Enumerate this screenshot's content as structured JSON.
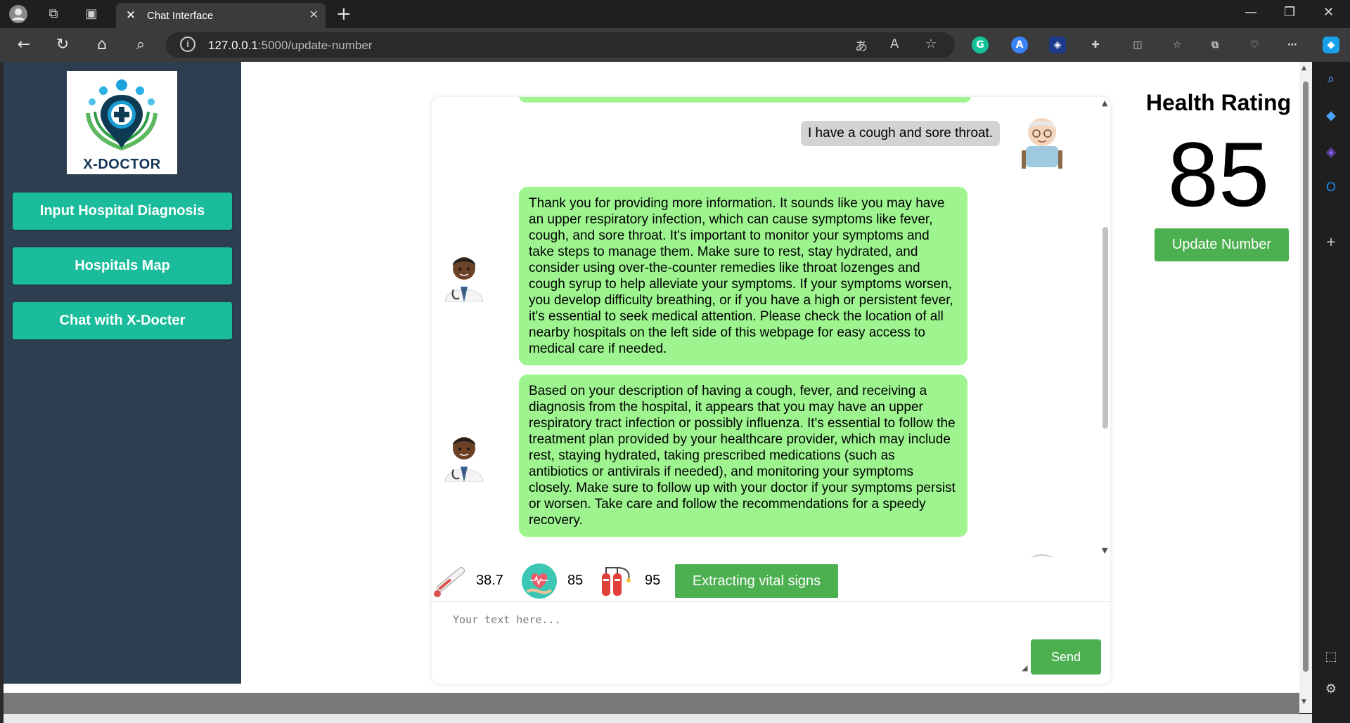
{
  "browser": {
    "tab_title": "Chat Interface",
    "url_host": "127.0.0.1",
    "url_path": ":5000/update-number"
  },
  "sidebar": {
    "logo_text": "X-DOCTOR",
    "items": [
      {
        "label": "Input Hospital Diagnosis"
      },
      {
        "label": "Hospitals Map"
      },
      {
        "label": "Chat with X-Docter"
      }
    ]
  },
  "chat": {
    "user_message": "I have a cough and sore throat.",
    "bot_messages": [
      {
        "text": "Thank you for providing more information. It sounds like you may have an upper respiratory infection, which can cause symptoms like fever, cough, and sore throat. It's important to monitor your symptoms and take steps to manage them. Make sure to rest, stay hydrated, and consider using over-the-counter remedies like throat lozenges and cough syrup to help alleviate your symptoms. If your symptoms worsen, you develop difficulty breathing, or if you have a high or persistent fever, it's essential to seek medical attention. Please check the location of all nearby hospitals on the left side of this webpage for easy access to medical care if needed."
      },
      {
        "text": "Based on your description of having a cough, fever, and receiving a diagnosis from the hospital, it appears that you may have an upper respiratory tract infection or possibly influenza. It's essential to follow the treatment plan provided by your healthcare provider, which may include rest, staying hydrated, taking prescribed medications (such as antibiotics or antivirals if needed), and monitoring your symptoms closely. Make sure to follow up with your doctor if your symptoms persist or worsen. Take care and follow the recommendations for a speedy recovery."
      }
    ],
    "input_placeholder": "Your text here...",
    "send_label": "Send"
  },
  "vitals": {
    "temperature": "38.7",
    "heart_rate": "85",
    "oxygen": "95",
    "extract_label": "Extracting vital signs"
  },
  "health": {
    "title": "Health Rating",
    "value": "85",
    "update_label": "Update Number"
  },
  "colors": {
    "sidebar_bg": "#2c3e50",
    "nav_button": "#1abc9c",
    "bot_bubble": "#9ef590",
    "user_bubble": "#d3d3d3",
    "action_green": "#4caf50"
  }
}
